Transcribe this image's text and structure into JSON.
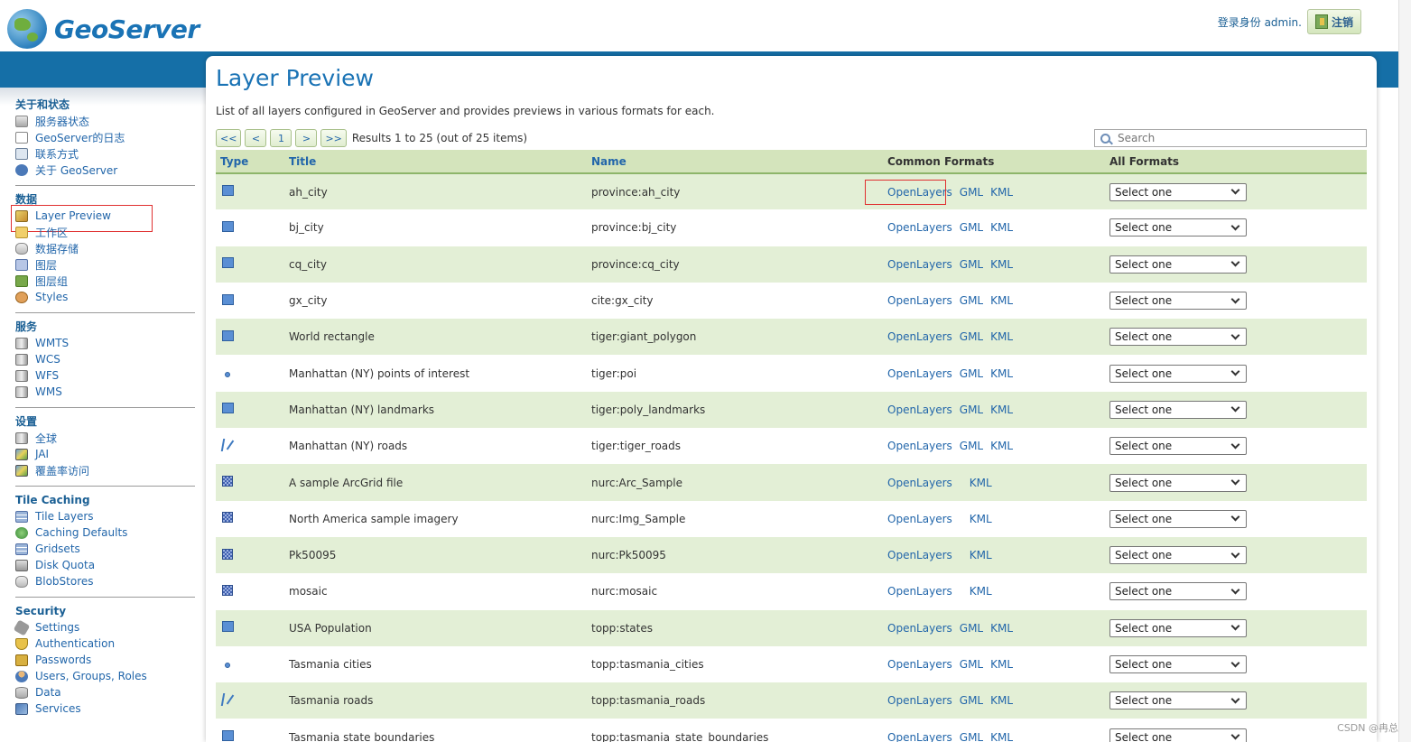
{
  "header": {
    "brand": "GeoServer",
    "user_label": "登录身份 admin.",
    "logout_label": "注销"
  },
  "sidebar": {
    "groups": [
      {
        "heading": "关于和状态",
        "items": [
          {
            "label": "服务器状态",
            "icon": "status-icon"
          },
          {
            "label": "GeoServer的日志",
            "icon": "log-icon"
          },
          {
            "label": "联系方式",
            "icon": "contact-icon"
          },
          {
            "label": "关于 GeoServer",
            "icon": "info-icon"
          }
        ]
      },
      {
        "heading": "数据",
        "items": [
          {
            "label": "Layer Preview",
            "icon": "layer-preview-icon"
          },
          {
            "label": "工作区",
            "icon": "folder-icon"
          },
          {
            "label": "数据存储",
            "icon": "database-icon"
          },
          {
            "label": "图层",
            "icon": "layer-icon"
          },
          {
            "label": "图层组",
            "icon": "layer-group-icon"
          },
          {
            "label": "Styles",
            "icon": "palette-icon"
          }
        ]
      },
      {
        "heading": "服务",
        "items": [
          {
            "label": "WMTS",
            "icon": "server-icon"
          },
          {
            "label": "WCS",
            "icon": "server-icon"
          },
          {
            "label": "WFS",
            "icon": "server-icon"
          },
          {
            "label": "WMS",
            "icon": "server-icon"
          }
        ]
      },
      {
        "heading": "设置",
        "items": [
          {
            "label": "全球",
            "icon": "server-icon"
          },
          {
            "label": "JAI",
            "icon": "jai-icon"
          },
          {
            "label": "覆盖率访问",
            "icon": "coverage-icon"
          }
        ]
      },
      {
        "heading": "Tile Caching",
        "items": [
          {
            "label": "Tile Layers",
            "icon": "grid-icon"
          },
          {
            "label": "Caching Defaults",
            "icon": "globe-icon"
          },
          {
            "label": "Gridsets",
            "icon": "grid-icon"
          },
          {
            "label": "Disk Quota",
            "icon": "disk-icon"
          },
          {
            "label": "BlobStores",
            "icon": "database-icon"
          }
        ]
      },
      {
        "heading": "Security",
        "items": [
          {
            "label": "Settings",
            "icon": "wrench-icon"
          },
          {
            "label": "Authentication",
            "icon": "shield-icon"
          },
          {
            "label": "Passwords",
            "icon": "lock-icon"
          },
          {
            "label": "Users, Groups, Roles",
            "icon": "users-icon"
          },
          {
            "label": "Data",
            "icon": "data-icon"
          },
          {
            "label": "Services",
            "icon": "services-icon"
          }
        ]
      }
    ]
  },
  "main": {
    "title": "Layer Preview",
    "description": "List of all layers configured in GeoServer and provides previews in various formats for each.",
    "pager": {
      "first": "<<",
      "prev": "<",
      "page": "1",
      "next": ">",
      "last": ">>"
    },
    "results_text": "Results 1 to 25 (out of 25 items)",
    "search_placeholder": "Search",
    "columns": {
      "type": "Type",
      "title": "Title",
      "name": "Name",
      "common": "Common Formats",
      "all": "All Formats"
    },
    "select_placeholder": "Select one",
    "rows": [
      {
        "type": "polygon",
        "title": "ah_city",
        "name": "province:ah_city",
        "formats": [
          "OpenLayers",
          "GML",
          "KML"
        ]
      },
      {
        "type": "polygon",
        "title": "bj_city",
        "name": "province:bj_city",
        "formats": [
          "OpenLayers",
          "GML",
          "KML"
        ]
      },
      {
        "type": "polygon",
        "title": "cq_city",
        "name": "province:cq_city",
        "formats": [
          "OpenLayers",
          "GML",
          "KML"
        ]
      },
      {
        "type": "polygon",
        "title": "gx_city",
        "name": "cite:gx_city",
        "formats": [
          "OpenLayers",
          "GML",
          "KML"
        ]
      },
      {
        "type": "polygon",
        "title": "World rectangle",
        "name": "tiger:giant_polygon",
        "formats": [
          "OpenLayers",
          "GML",
          "KML"
        ]
      },
      {
        "type": "point",
        "title": "Manhattan (NY) points of interest",
        "name": "tiger:poi",
        "formats": [
          "OpenLayers",
          "GML",
          "KML"
        ]
      },
      {
        "type": "polygon",
        "title": "Manhattan (NY) landmarks",
        "name": "tiger:poly_landmarks",
        "formats": [
          "OpenLayers",
          "GML",
          "KML"
        ]
      },
      {
        "type": "line",
        "title": "Manhattan (NY) roads",
        "name": "tiger:tiger_roads",
        "formats": [
          "OpenLayers",
          "GML",
          "KML"
        ]
      },
      {
        "type": "raster",
        "title": "A sample ArcGrid file",
        "name": "nurc:Arc_Sample",
        "formats": [
          "OpenLayers",
          "",
          "KML"
        ]
      },
      {
        "type": "raster",
        "title": "North America sample imagery",
        "name": "nurc:Img_Sample",
        "formats": [
          "OpenLayers",
          "",
          "KML"
        ]
      },
      {
        "type": "raster",
        "title": "Pk50095",
        "name": "nurc:Pk50095",
        "formats": [
          "OpenLayers",
          "",
          "KML"
        ]
      },
      {
        "type": "raster",
        "title": "mosaic",
        "name": "nurc:mosaic",
        "formats": [
          "OpenLayers",
          "",
          "KML"
        ]
      },
      {
        "type": "polygon",
        "title": "USA Population",
        "name": "topp:states",
        "formats": [
          "OpenLayers",
          "GML",
          "KML"
        ]
      },
      {
        "type": "point",
        "title": "Tasmania cities",
        "name": "topp:tasmania_cities",
        "formats": [
          "OpenLayers",
          "GML",
          "KML"
        ]
      },
      {
        "type": "line",
        "title": "Tasmania roads",
        "name": "topp:tasmania_roads",
        "formats": [
          "OpenLayers",
          "GML",
          "KML"
        ]
      },
      {
        "type": "polygon",
        "title": "Tasmania state boundaries",
        "name": "topp:tasmania_state_boundaries",
        "formats": [
          "OpenLayers",
          "GML",
          "KML"
        ]
      }
    ]
  },
  "watermark": "CSDN @冉总",
  "colors": {
    "brand_blue": "#156fa7",
    "row_green": "#e3efd6",
    "header_green": "#d4e4bc",
    "link": "#2266aa",
    "highlight_red": "#e03030"
  }
}
